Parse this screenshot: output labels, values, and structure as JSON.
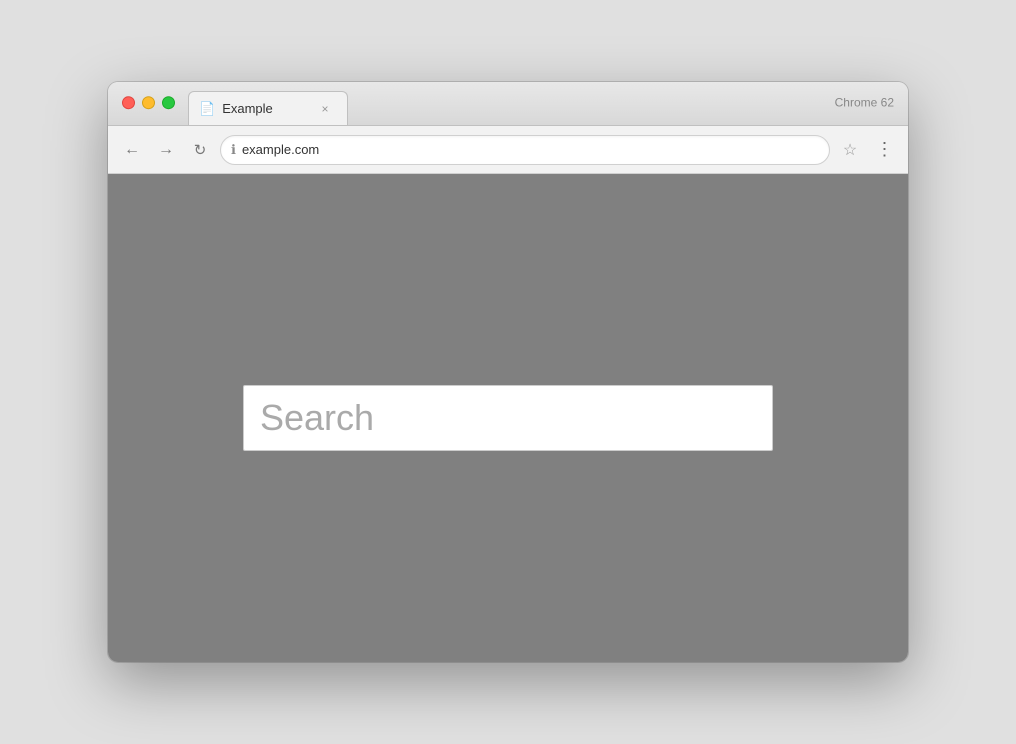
{
  "browser": {
    "tab": {
      "icon": "📄",
      "title": "Example",
      "close": "×"
    },
    "chrome_version": "Chrome 62",
    "toolbar": {
      "back_label": "←",
      "forward_label": "→",
      "refresh_label": "↻",
      "address": "example.com",
      "star_label": "☆",
      "menu_label": "⋮"
    },
    "page": {
      "search_placeholder": "Search"
    }
  }
}
